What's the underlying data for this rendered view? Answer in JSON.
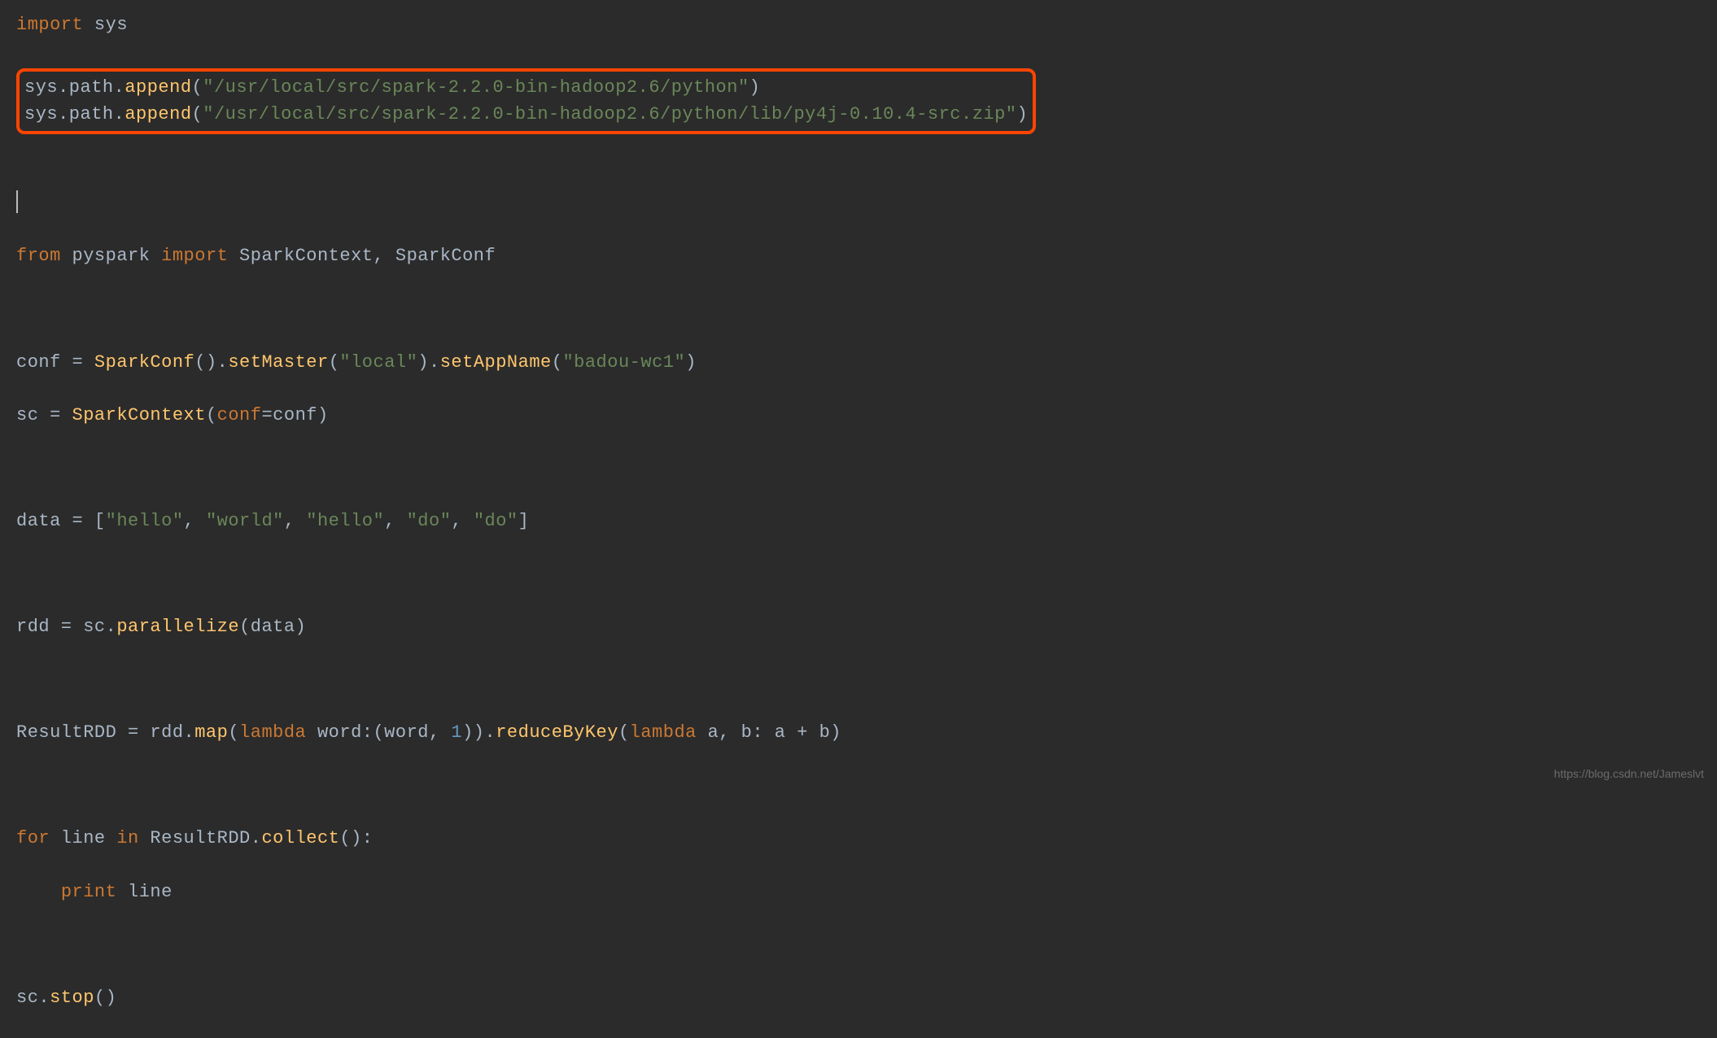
{
  "line1": {
    "import": "import",
    "sys": " sys"
  },
  "highlight": {
    "l1": {
      "p1": "sys.path.",
      "p2": "append",
      "p3": "(",
      "p4": "\"/usr/local/src/spark-2.2.0-bin-hadoop2.6/python\"",
      "p5": ")"
    },
    "l2": {
      "p1": "sys.path.",
      "p2": "append",
      "p3": "(",
      "p4": "\"/usr/local/src/spark-2.2.0-bin-hadoop2.6/python/lib/py4j-0.10.4-src.zip\"",
      "p5": ")"
    }
  },
  "line_from": {
    "from": "from",
    "pyspark": " pyspark ",
    "import": "import",
    "rest": " SparkContext, SparkConf"
  },
  "line_conf": {
    "p1": "conf = ",
    "p2": "SparkConf",
    "p3": "().",
    "p4": "setMaster",
    "p5": "(",
    "p6": "\"local\"",
    "p7": ").",
    "p8": "setAppName",
    "p9": "(",
    "p10": "\"badou-wc1\"",
    "p11": ")"
  },
  "line_sc": {
    "p1": "sc = ",
    "p2": "SparkContext",
    "p3": "(",
    "p4": "conf",
    "p5": "=conf)"
  },
  "line_data": {
    "p1": "data = [",
    "s1": "\"hello\"",
    "c1": ", ",
    "s2": "\"world\"",
    "c2": ", ",
    "s3": "\"hello\"",
    "c3": ", ",
    "s4": "\"do\"",
    "c4": ", ",
    "s5": "\"do\"",
    "p2": "]"
  },
  "line_rdd": {
    "p1": "rdd = sc.",
    "p2": "parallelize",
    "p3": "(data)"
  },
  "line_result": {
    "p1": "ResultRDD = rdd.",
    "p2": "map",
    "p3": "(",
    "p4": "lambda",
    "p5": " word:(word, ",
    "p6": "1",
    "p7": ")).",
    "p8": "reduceByKey",
    "p9": "(",
    "p10": "lambda",
    "p11": " a, b: a + b)"
  },
  "line_for": {
    "p1": "for",
    "p2": " line ",
    "p3": "in",
    "p4": " ResultRDD.",
    "p5": "collect",
    "p6": "():"
  },
  "line_print": {
    "p1": "    ",
    "p2": "print",
    "p3": " line"
  },
  "line_stop": {
    "p1": "sc.",
    "p2": "stop",
    "p3": "()"
  },
  "watermark": "https://blog.csdn.net/Jameslvt"
}
